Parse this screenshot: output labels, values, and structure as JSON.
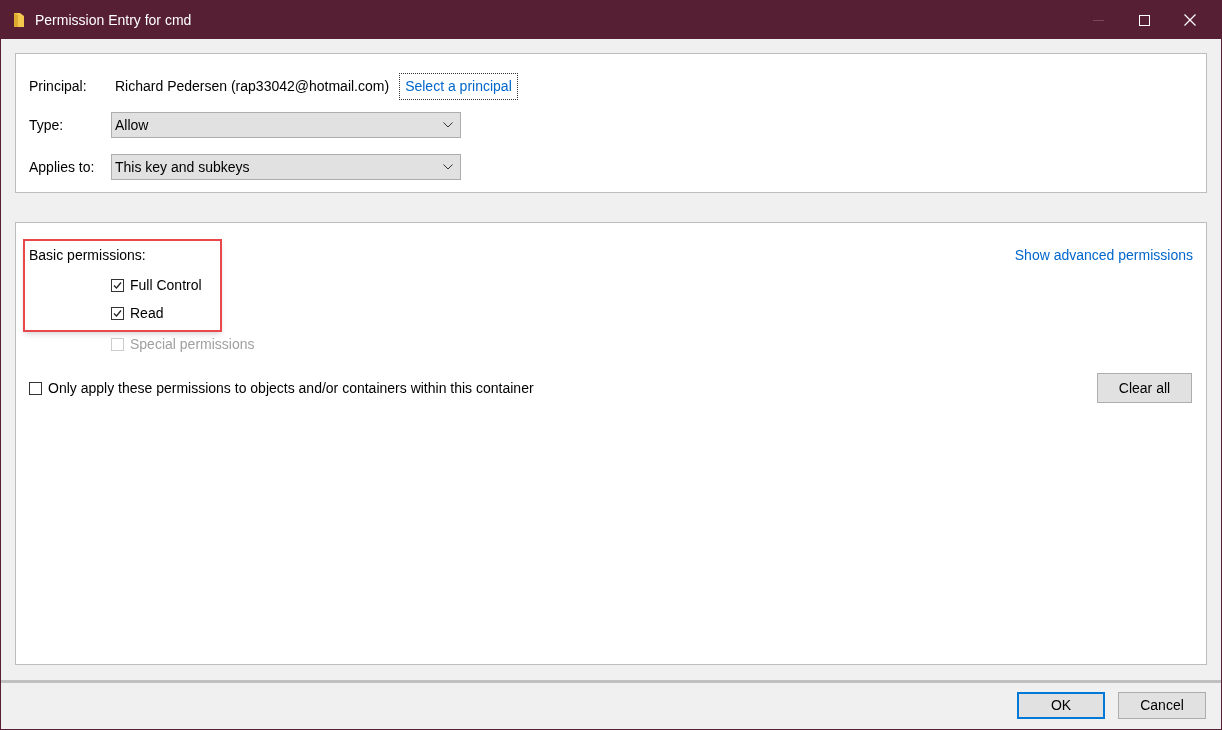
{
  "window": {
    "title": "Permission Entry for cmd",
    "minimize_disabled": true
  },
  "principal": {
    "label": "Principal:",
    "value": "Richard Pedersen (rap33042@hotmail.com)",
    "link": "Select a principal"
  },
  "fields": [
    {
      "label": "Type:",
      "value": "Allow"
    },
    {
      "label": "Applies to:",
      "value": "This key and subkeys"
    }
  ],
  "permissions": {
    "heading": "Basic permissions:",
    "highlighted": true,
    "advanced_link": "Show advanced permissions",
    "items": [
      {
        "label": "Full Control",
        "checked": true,
        "disabled": false
      },
      {
        "label": "Read",
        "checked": true,
        "disabled": false
      },
      {
        "label": "Special permissions",
        "checked": false,
        "disabled": true
      }
    ],
    "apply_only": {
      "label": "Only apply these permissions to objects and/or containers within this container",
      "checked": false
    },
    "clear_button": "Clear all"
  },
  "buttons": [
    {
      "label": "OK",
      "selected": true
    },
    {
      "label": "Cancel",
      "selected": false
    }
  ]
}
